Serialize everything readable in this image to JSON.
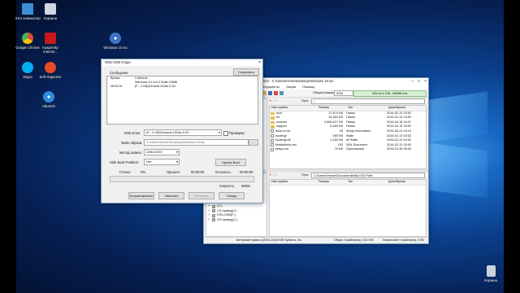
{
  "desktop": {
    "icons": [
      {
        "label": "Этот компьютер",
        "color": "#3a8fd6"
      },
      {
        "label": "Google Chrome",
        "color": "#dd4b39"
      },
      {
        "label": "Skype",
        "color": "#00aff0"
      },
      {
        "label": "UltraISO",
        "color": "#2e8bd8"
      },
      {
        "label": "Корзина",
        "color": "#cfd8e3"
      },
      {
        "label": "Kaspersky Internet...",
        "color": "#c8171e"
      },
      {
        "label": "Soft Organizer",
        "color": "#e84a24"
      },
      {
        "label": "Windows 10.iso",
        "color": "#3e74c8"
      },
      {
        "label": "Корзина",
        "color": "#c9d3de"
      }
    ]
  },
  "write_dialog": {
    "title": "Write Disk Image",
    "message_label": "Сообщение",
    "save_button": "Сохранить",
    "columns": [
      "Время",
      "Событие"
    ],
    "log": [
      {
        "time": "",
        "event": "Windows 10 v10.0 Build 10586"
      },
      {
        "time": "08:06:31",
        "event": "(F:, 4 GB)General UDisk          5.00"
      }
    ],
    "disk_drive_label": "Disk Drive:",
    "disk_drive_value": "(F:, 4 GB)General UDisk          5.00",
    "verify_label": "Проверка",
    "image_file_label": "Файл образа:",
    "image_file_value": "C:\\Users\\Home\\Desktop\\Windows 10.iso",
    "write_method_label": "Метод записи:",
    "write_method_value": "USB-HDD+",
    "hide_boot_label": "Hide Boot Partition:",
    "hide_boot_value": "Нет",
    "xboot_button": "Xpress Boot",
    "done_label": "Готово:",
    "done_value": "0%",
    "elapsed_label": "Прошло:",
    "elapsed_value": "00:00:00",
    "remaining_label": "Осталось:",
    "remaining_value": "00:00:00",
    "speed_label": "Скорость:",
    "speed_value": "0KB/s",
    "progress_fraction": 0.0,
    "buttons": [
      "Форматировать",
      "Записать",
      "Прервать",
      "Назад"
    ]
  },
  "ultraiso": {
    "title": "UltraISO - C:\\Users\\Home\\Desktop\\Windows 10.iso",
    "menu": [
      "Инструменты",
      "Опции",
      "Помощь"
    ],
    "size_label": "Общий размер:",
    "size_value": "3GB",
    "capacity_text": "89% of 4.7GB - 500MB free",
    "top_path_label": "Путь:",
    "top_path": "/",
    "top_columns": [
      "Имя файла",
      "Размер",
      "Тип",
      "Дата/Время"
    ],
    "top_rows": [
      {
        "name": "boot",
        "size": "17,674 KB",
        "type": "Папка",
        "date": "2016-02-13 15:52",
        "kind": "folder"
      },
      {
        "name": "efi",
        "size": "15,362 KB",
        "type": "Папка",
        "date": "2016-02-13 15:52",
        "kind": "folder"
      },
      {
        "name": "sources",
        "size": "2,666,417 KB",
        "type": "Папка",
        "date": "2016-04-18 15:07",
        "kind": "folder"
      },
      {
        "name": "support",
        "size": "6,489 KB",
        "type": "Папка",
        "date": "2016-02-13 15:52",
        "kind": "folder"
      },
      {
        "name": "autorun.inf",
        "size": "43",
        "type": "Setup Information",
        "date": "2016-03-21 04:13",
        "kind": "file"
      },
      {
        "name": "bootmgr",
        "size": "390 KB",
        "type": "Файл",
        "date": "2016-02-13 15:52",
        "kind": "file"
      },
      {
        "name": "bootmgr.efi",
        "size": "1,160 KB",
        "type": "efi Файл",
        "date": "2016-02-13 15:52",
        "kind": "file"
      },
      {
        "name": "MediaMeta.xml",
        "size": "152",
        "type": "XML Document",
        "date": "2016-02-13 15:52",
        "kind": "file"
      },
      {
        "name": "setup.exe",
        "size": "79 KB",
        "type": "Приложение",
        "date": "2015-10-30 08:44",
        "kind": "file"
      }
    ],
    "bottom_path_label": "Путь:",
    "bottom_path": "C:\\Users\\Home\\Documents\\My ISO Files",
    "bottom_columns": [
      "Имя файла",
      "Размер",
      "Тип",
      "Дата/Время"
    ],
    "tree": [
      "(G:)",
      "CD-привод(I:)",
      "ESD-USB(F:)",
      "CD-привод(J:)"
    ],
    "status_copyright": "Авторские права (c)2002-2016 EZB Systems, Inc.",
    "status_image": "Образ: 5 файла(ов), 1414 KB",
    "status_local": "Локальный: 0 файла(ов), 0 KB"
  }
}
